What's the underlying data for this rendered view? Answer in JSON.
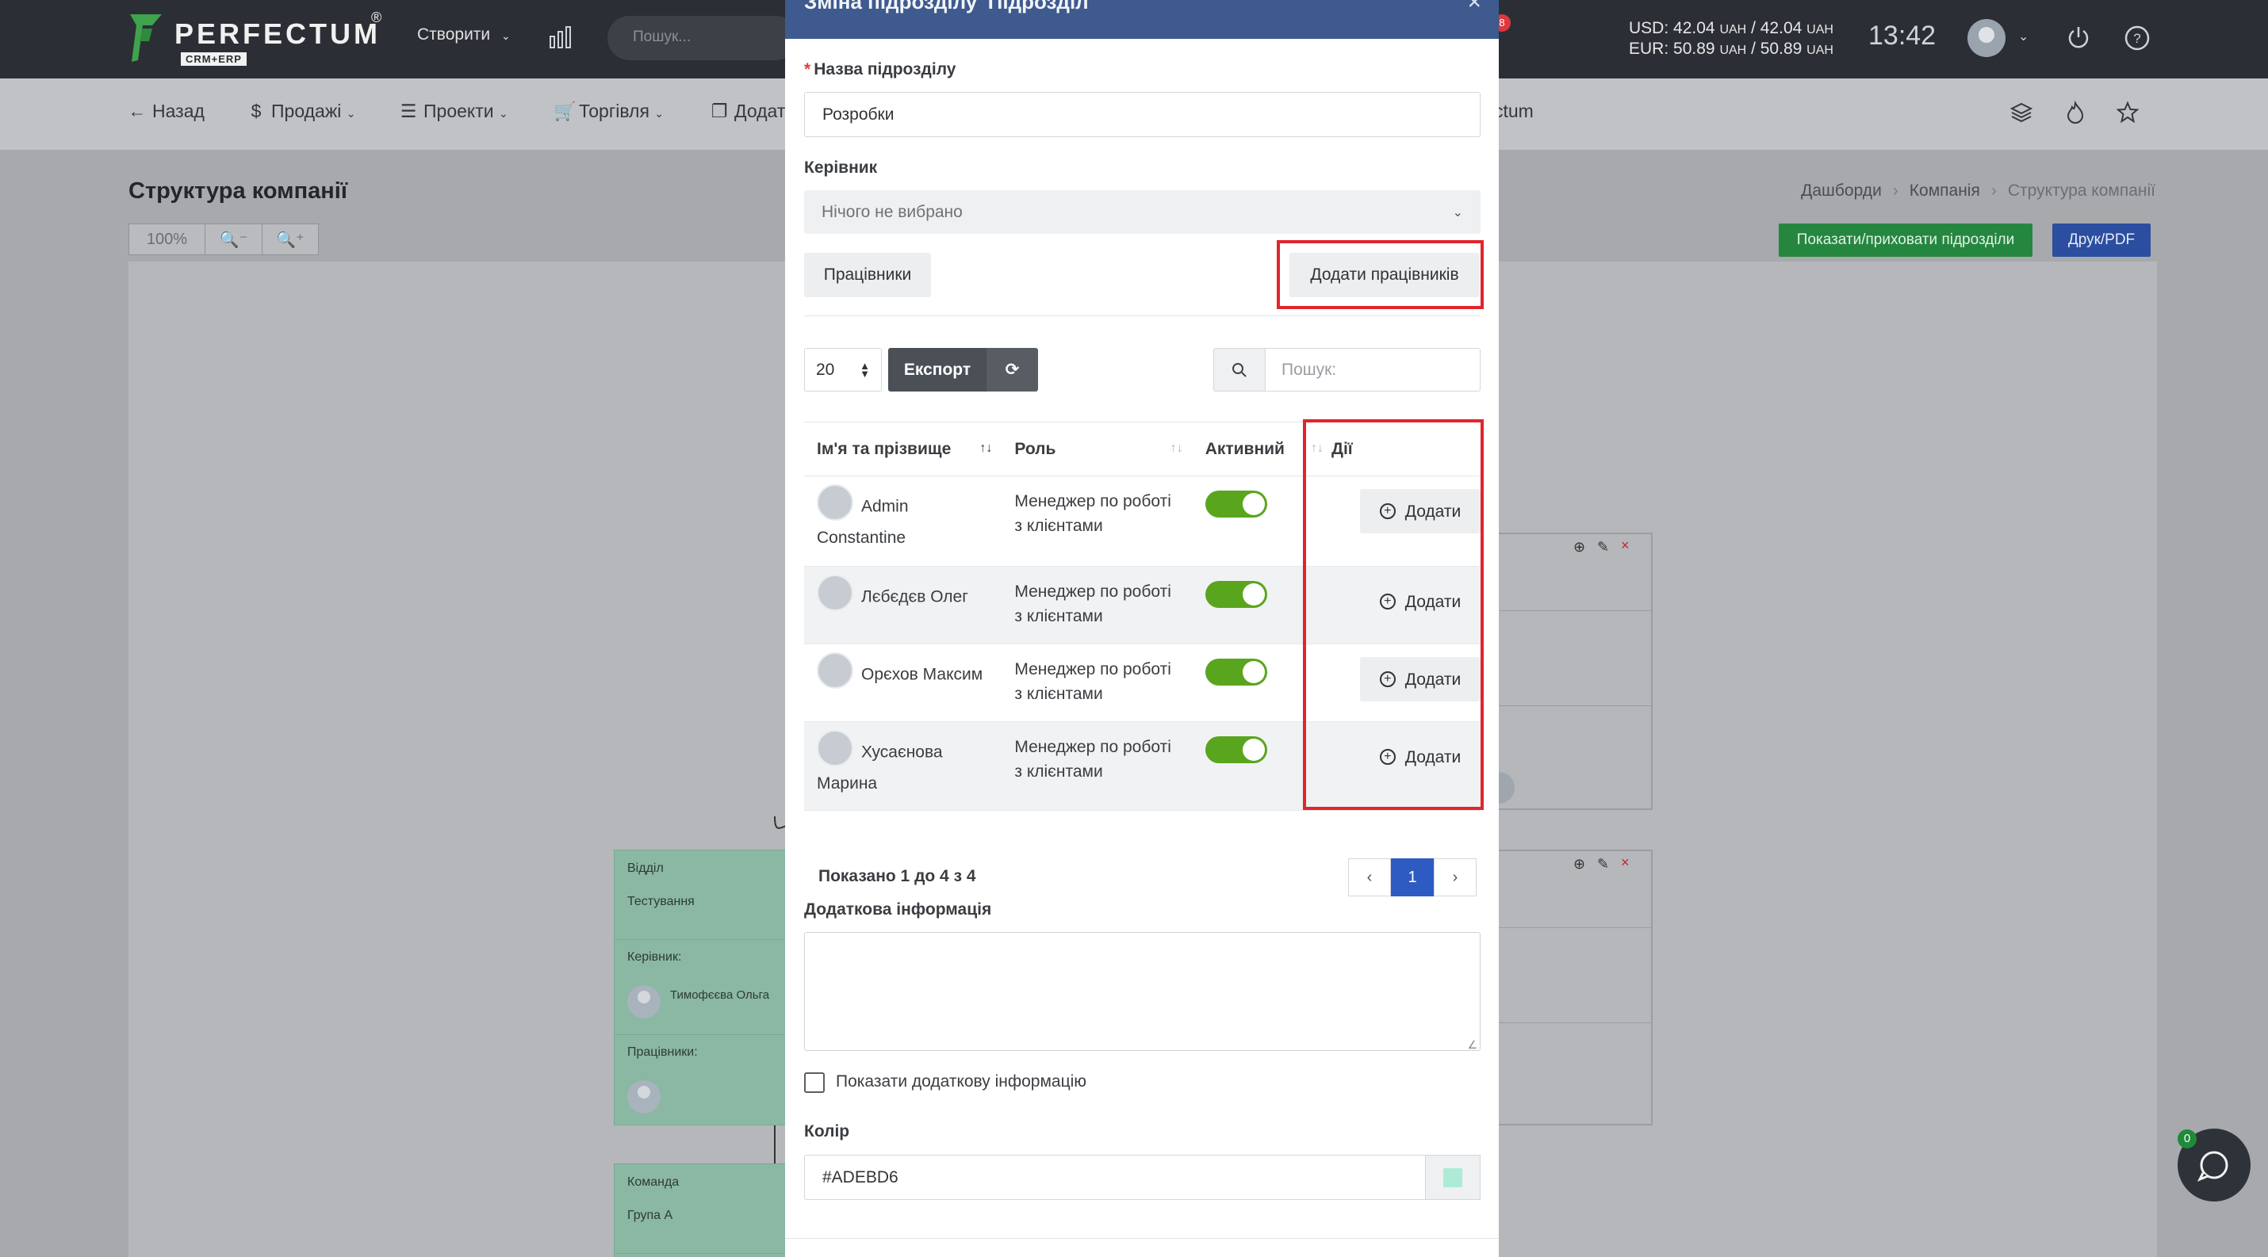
{
  "topbar": {
    "logo_text": "PERFECTUM",
    "logo_reg": "®",
    "logo_sub": "CRM+ERP",
    "create_label": "Створити",
    "search_placeholder": "Пошук...",
    "notification_count": "8",
    "rates": {
      "usd_label": "USD:",
      "usd_buy": "42.04",
      "usd_sell": "42.04",
      "eur_label": "EUR:",
      "eur_buy": "50.89",
      "eur_sell": "50.89",
      "currency": "UAH",
      "separator": "/"
    },
    "clock": "13:42"
  },
  "subnav": {
    "back": "Назад",
    "sales": "Продажі",
    "projects": "Проекти",
    "trade": "Торгівля",
    "add_partial": "Додат",
    "perfectum_partial": "ctum"
  },
  "page": {
    "title": "Структура компанії",
    "breadcrumbs": [
      "Дашборди",
      "Компанія",
      "Структура компанії"
    ],
    "zoom": "100%",
    "show_hide_button": "Показати/приховати підрозділи",
    "print_button": "Друк/PDF"
  },
  "tree": {
    "dept_label": "Відділ",
    "dept_name": "Тестування",
    "manager_label": "Керівник:",
    "manager_name": "Тимофєєва Ольга",
    "employees_label": "Працівники:",
    "team_label": "Команда",
    "team_name": "Група А"
  },
  "modal": {
    "title": "Зміна підрозділу 'Підрозділ'",
    "close_glyph": "×",
    "name_label": "Назва підрозділу",
    "required_mark": "*",
    "name_value": "Розробки",
    "manager_label": "Керівник",
    "manager_placeholder": "Нічого не вибрано",
    "employees_button": "Працівники",
    "add_employees_button": "Додати працівників",
    "page_size": "20",
    "export_button": "Експорт",
    "search_placeholder": "Пошук:",
    "columns": [
      "Ім'я та прізвище",
      "Роль",
      "Активний",
      "Дії"
    ],
    "rows": [
      {
        "name_first": "Admin",
        "name_second": "Constantine",
        "role_line1": "Менеджер по роботі",
        "role_line2": "з клієнтами",
        "active": true,
        "action": "Додати"
      },
      {
        "name_first": "Лєбєдєв Олег",
        "name_second": "",
        "role_line1": "Менеджер по роботі",
        "role_line2": "з клієнтами",
        "active": true,
        "action": "Додати"
      },
      {
        "name_first": "Орєхов Максим",
        "name_second": "",
        "role_line1": "Менеджер по роботі",
        "role_line2": "з клієнтами",
        "active": true,
        "action": "Додати"
      },
      {
        "name_first": "Хусаєнова",
        "name_second": "Марина",
        "role_line1": "Менеджер по роботі",
        "role_line2": "з клієнтами",
        "active": true,
        "action": "Додати"
      }
    ],
    "info_text": "Показано 1 до 4 з 4",
    "pagination": {
      "prev": "‹",
      "current": "1",
      "next": "›"
    },
    "extra_info_label": "Додаткова інформація",
    "show_extra_label": "Показати додаткову інформацію",
    "color_label": "Колір",
    "color_value": "#ADEBD6"
  },
  "colors": {
    "topbar": "#2b2f35",
    "modal_header": "#3e5a8e",
    "toggle_on": "#5aa51e",
    "highlight": "#e0262c",
    "pagination_active": "#2e5bc2",
    "swatch": "#ADEBD6"
  },
  "chat": {
    "badge": "0"
  }
}
